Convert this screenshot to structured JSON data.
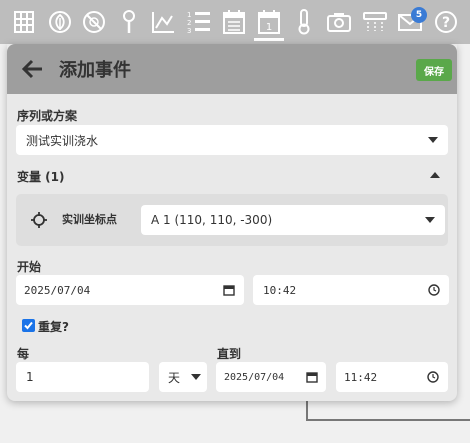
{
  "toolbar": {
    "icons": [
      "grid-icon",
      "leaf-icon",
      "no-sign-icon",
      "pin-icon",
      "chart-icon",
      "numbered-list-icon",
      "calendar-icon",
      "calendar-day-icon",
      "thermometer-icon",
      "camera-icon",
      "sprinkler-icon",
      "mail-icon",
      "help-icon"
    ],
    "active": "calendar-day-icon",
    "calendar_day": "1",
    "mail_badge": "5"
  },
  "panel": {
    "title": "添加事件",
    "save_label": "保存",
    "sequence_label": "序列或方案",
    "sequence_value": "测试实训浇水",
    "variables_label": "变量 (1)",
    "variable_name": "实训坐标点",
    "variable_value": "A 1 (110, 110, -300)",
    "start_label": "开始",
    "start_date": "2025/07/04",
    "start_time": "10:42",
    "repeat_label": "重复?",
    "repeat_checked": true,
    "every_label": "每",
    "every_value": "1",
    "unit_value": "天",
    "until_label": "直到",
    "until_date": "2025/07/04",
    "until_time": "11:42"
  },
  "colors": {
    "toolbar_bg": "#bdbdbd",
    "header_bg": "#9e9e9e",
    "save_green": "#5aa84a",
    "checkbox_blue": "#1a73e8",
    "badge_blue": "#3a7bd5"
  }
}
